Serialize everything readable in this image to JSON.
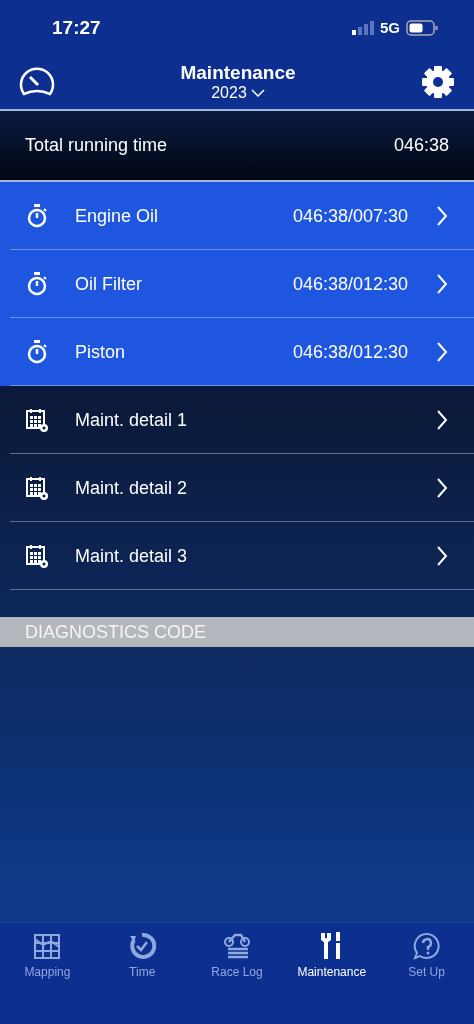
{
  "status_bar": {
    "time": "17:27",
    "network": "5G"
  },
  "header": {
    "title": "Maintenance",
    "year": "2023"
  },
  "total": {
    "label": "Total running time",
    "value": "046:38"
  },
  "rows": [
    {
      "kind": "timer",
      "label": "Engine Oil",
      "value": "046:38/007:30"
    },
    {
      "kind": "timer",
      "label": "Oil Filter",
      "value": "046:38/012:30"
    },
    {
      "kind": "timer",
      "label": "Piston",
      "value": "046:38/012:30"
    },
    {
      "kind": "schedule",
      "label": "Maint. detail 1"
    },
    {
      "kind": "schedule",
      "label": "Maint. detail 2"
    },
    {
      "kind": "schedule",
      "label": "Maint. detail 3"
    }
  ],
  "section": {
    "title": "DIAGNOSTICS CODE"
  },
  "tabs": [
    {
      "kind": "map",
      "label": "Mapping",
      "selected": false
    },
    {
      "kind": "time",
      "label": "Time",
      "selected": false
    },
    {
      "kind": "bike",
      "label": "Race Log",
      "selected": false
    },
    {
      "kind": "tools",
      "label": "Maintenance",
      "selected": true
    },
    {
      "kind": "help",
      "label": "Set Up",
      "selected": false
    }
  ]
}
